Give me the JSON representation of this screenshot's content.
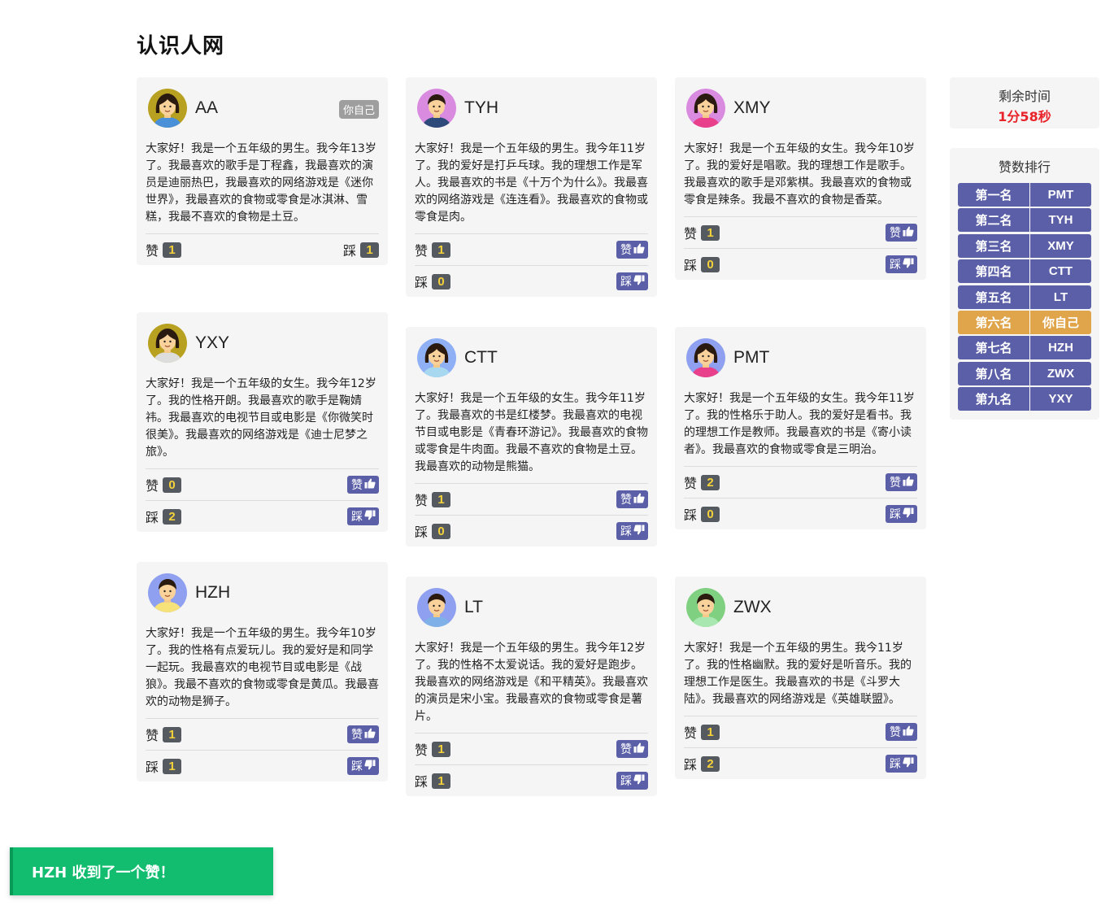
{
  "app": {
    "title": "认识人网"
  },
  "labels": {
    "like": "赞",
    "dislike": "踩",
    "like_btn": "赞",
    "dislike_btn": "踩",
    "self_badge": "你自己"
  },
  "cards": [
    {
      "name": "AA",
      "self": true,
      "avatar": "female-avatar",
      "intro": "大家好！我是一个五年级的男生。我今年13岁了。我最喜欢的歌手是丁程鑫，我最喜欢的演员是迪丽热巴，我最喜欢的网络游戏是《迷你世界》，我最喜欢的食物或零食是冰淇淋、雪糕，我最不喜欢的食物是土豆。",
      "likes": "1",
      "dislikes": "1"
    },
    {
      "name": "YXY",
      "self": false,
      "avatar": "female-avatar",
      "intro": "大家好！我是一个五年级的女生。我今年12岁了。我的性格开朗。我最喜欢的歌手是鞠婧祎。我最喜欢的电视节目或电影是《你微笑时很美》。我最喜欢的网络游戏是《迪士尼梦之旅》。",
      "likes": "0",
      "dislikes": "2"
    },
    {
      "name": "HZH",
      "self": false,
      "avatar": "male-avatar",
      "intro": "大家好！我是一个五年级的男生。我今年10岁了。我的性格有点爱玩儿。我的爱好是和同学一起玩。我最喜欢的电视节目或电影是《战狼》。我最不喜欢的食物或零食是黄瓜。我最喜欢的动物是狮子。",
      "likes": "1",
      "dislikes": "1"
    },
    {
      "name": "TYH",
      "self": false,
      "avatar": "male-avatar",
      "intro": "大家好！我是一个五年级的男生。我今年11岁了。我的爱好是打乒乓球。我的理想工作是军人。我最喜欢的书是《十万个为什么》。我最喜欢的网络游戏是《连连看》。我最喜欢的食物或零食是肉。",
      "likes": "1",
      "dislikes": "0"
    },
    {
      "name": "CTT",
      "self": false,
      "avatar": "female-avatar",
      "intro": "大家好！我是一个五年级的女生。我今年11岁了。我最喜欢的书是红楼梦。我最喜欢的电视节目或电影是《青春环游记》。我最喜欢的食物或零食是牛肉面。我最不喜欢的食物是土豆。我最喜欢的动物是熊猫。",
      "likes": "1",
      "dislikes": "0"
    },
    {
      "name": "LT",
      "self": false,
      "avatar": "male-avatar",
      "intro": "大家好！我是一个五年级的男生。我今年12岁了。我的性格不太爱说话。我的爱好是跑步。我最喜欢的网络游戏是《和平精英》。我最喜欢的演员是宋小宝。我最喜欢的食物或零食是薯片。",
      "likes": "1",
      "dislikes": "1"
    },
    {
      "name": "XMY",
      "self": false,
      "avatar": "female-avatar",
      "intro": "大家好！我是一个五年级的女生。我今年10岁了。我的爱好是唱歌。我的理想工作是歌手。我最喜欢的歌手是邓紫棋。我最喜欢的食物或零食是辣条。我最不喜欢的食物是香菜。",
      "likes": "1",
      "dislikes": "0"
    },
    {
      "name": "PMT",
      "self": false,
      "avatar": "female-avatar",
      "intro": "大家好！我是一个五年级的女生。我今年11岁了。我的性格乐于助人。我的爱好是看书。我的理想工作是教师。我最喜欢的书是《寄小读者》。我最喜欢的食物或零食是三明治。",
      "likes": "2",
      "dislikes": "0"
    },
    {
      "name": "ZWX",
      "self": false,
      "avatar": "male-avatar",
      "intro": "大家好！我是一个五年级的男生。我今11岁了。我的性格幽默。我的爱好是听音乐。我的理想工作是医生。我最喜欢的书是《斗罗大陆》。我最喜欢的网络游戏是《英雄联盟》。",
      "likes": "1",
      "dislikes": "2"
    }
  ],
  "timer": {
    "label": "剩余时间",
    "value": "1分58秒"
  },
  "ranking": {
    "label": "赞数排行",
    "rows": [
      {
        "rank": "第一名",
        "name": "PMT"
      },
      {
        "rank": "第二名",
        "name": "TYH"
      },
      {
        "rank": "第三名",
        "name": "XMY"
      },
      {
        "rank": "第四名",
        "name": "CTT"
      },
      {
        "rank": "第五名",
        "name": "LT"
      },
      {
        "rank": "第六名",
        "name": "你自己"
      },
      {
        "rank": "第七名",
        "name": "HZH"
      },
      {
        "rank": "第八名",
        "name": "ZWX"
      },
      {
        "rank": "第九名",
        "name": "YXY"
      }
    ]
  },
  "toast": {
    "text": "HZH 收到了一个赞！"
  },
  "colors": {
    "button": "#5b5fa8",
    "self_highlight": "#e0a44a",
    "timer": "#e8232a",
    "toast": "#12bd6f"
  }
}
